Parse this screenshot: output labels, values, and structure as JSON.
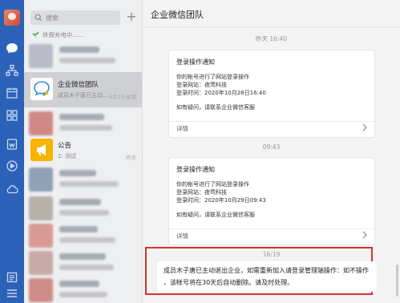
{
  "search": {
    "placeholder": "搜索"
  },
  "status_text": "休假充电中......",
  "conversations": [
    {
      "title": "企业微信团队",
      "preview": "成员木子唐已主动...",
      "time": "4月1日星期",
      "selected": true
    },
    {
      "title": "公告",
      "preview": "2: 测试",
      "time": "昨天"
    }
  ],
  "chat": {
    "title": "企业微信团队",
    "messages": [
      {
        "time": "昨天 16:40",
        "title": "登录操作通知",
        "lines": [
          "你的帐号进行了网站登录操作",
          "登录网站：夜莺科技",
          "登录时间：2020年10月28日16:40",
          "如有疑问，请联系企业微信客服"
        ],
        "detail": "详情"
      },
      {
        "time": "09:43",
        "title": "登录操作通知",
        "lines": [
          "你的帐号进行了网站登录操作",
          "登录网站：夜莺科技",
          "登录时间：2020年10月29日09:43",
          "如有疑问，请联系企业微信客服"
        ],
        "detail": "详情"
      },
      {
        "time": "16:19",
        "text_line1": "成员木子唐已主动退出企业，如需重新加入请登录管理端操作：如不操作",
        "text_line2": "，该帐号将在30天后自动删除。请及时处理。"
      }
    ]
  },
  "colors": {
    "rail": "#2b62b8",
    "highlight": "#d9322c",
    "announce": "#f5b400"
  }
}
